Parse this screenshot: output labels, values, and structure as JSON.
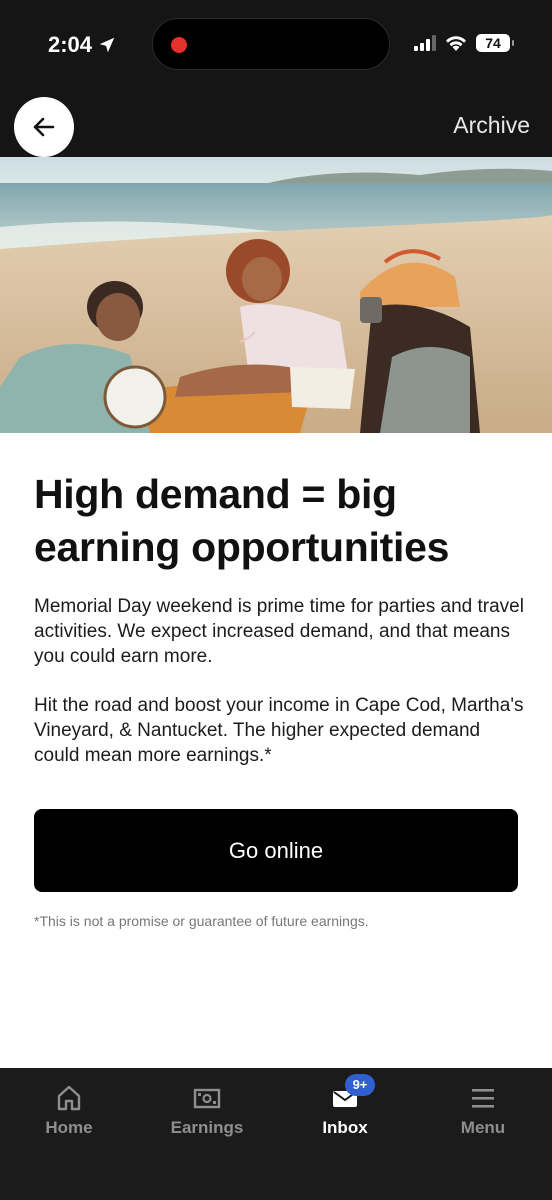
{
  "status_bar": {
    "time": "2:04",
    "battery": "74"
  },
  "header": {
    "archive_label": "Archive"
  },
  "article": {
    "title": "High demand = big earning opportunities",
    "paragraph_1": "Memorial Day weekend is prime time for parties and travel activities. We expect increased demand, and that means you could earn more.",
    "paragraph_2": "Hit the road and boost your income in Cape Cod, Martha's Vineyard, & Nantucket. The higher expected demand could mean more earnings.*",
    "cta_label": "Go online",
    "disclaimer": "*This is not a promise or guarantee of future earnings."
  },
  "tabbar": {
    "items": [
      {
        "label": "Home",
        "icon": "home-icon"
      },
      {
        "label": "Earnings",
        "icon": "earnings-icon"
      },
      {
        "label": "Inbox",
        "icon": "inbox-icon",
        "badge": "9+"
      },
      {
        "label": "Menu",
        "icon": "menu-icon"
      }
    ],
    "active": "Inbox"
  },
  "colors": {
    "dark_bg": "#151515",
    "cta_bg": "#000000",
    "badge": "#2f5fd0",
    "record_dot": "#e5312b"
  }
}
